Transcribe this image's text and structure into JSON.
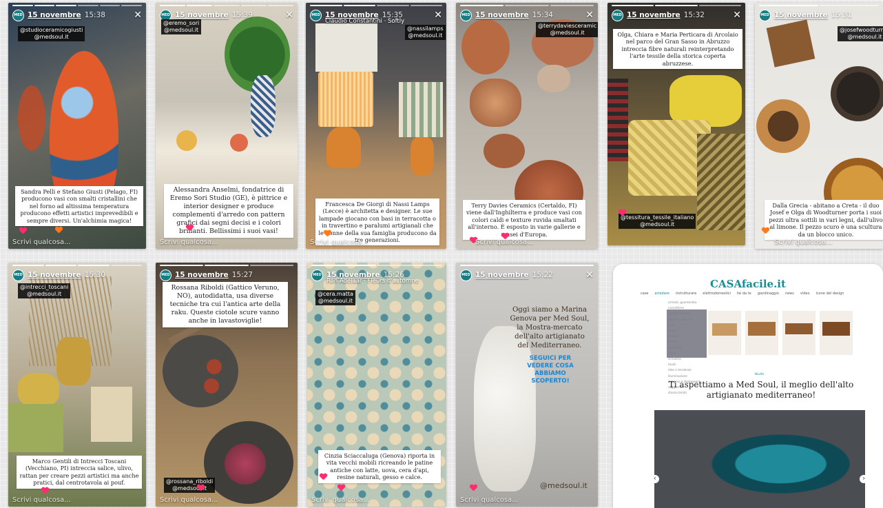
{
  "stories": [
    {
      "account": "15 novembre",
      "time": "15:38",
      "tags": [
        "@studioceramicogiusti",
        "@medsoul.it"
      ],
      "caption": "Sandra Pelli e Stefano Giusti (Pelago, FI) producono vasi con smalti cristallini che nel forno ad altissima temperatura producono effetti artistici imprevedibili e sempre diversi. Un'alchimia magica!",
      "write": "Scrivi qualcosa..."
    },
    {
      "account": "15 novembre",
      "time": "15:39",
      "tags": [
        "@eremo_sori",
        "@medsoul.it"
      ],
      "caption": "Alessandra Anselmi, fondatrice di Eremo Sori Studio (GE), è pittrice e interior designer e produce complementi d'arredo con pattern grafici dai segni decisi e i colori brillanti. Bellissimi i suoi vasi!",
      "write": "Scrivi qualcosa..."
    },
    {
      "account": "15 novembre",
      "time": "15:35",
      "sub": "Claudio Constantini · Softly",
      "tags": [
        "@nassilamps",
        "@medsoul.it"
      ],
      "caption": "Francesca De Giorgi di Nassi Lamps (Lecce) è architetta e designer. Le sue lampade giocano con basi in terracotta o in travertino e paralumi artigianali che le donne della sua famiglia producono da tre generazioni.",
      "write": "Scrivi qualcosa..."
    },
    {
      "account": "15 novembre",
      "time": "15:34",
      "tags": [
        "@terrydaviesceramic",
        "@medsoul.it"
      ],
      "caption": "Terry Davies Ceramics (Certaldo, FI) viene dall'Inghilterra e produce vasi con colori caldi e texture ruvida smaltati all'interno. È esposto in varie gallerie e musei d'Europa.",
      "write": "Scrivi qualcosa..."
    },
    {
      "account": "15 novembre",
      "time": "15:32",
      "tags": [
        "@tessitura_tessile_italiano",
        "@medsoul.it"
      ],
      "caption": "Olga, Chiara e Maria Perticara di Arcolaio nel parco del Gran Sasso in Abruzzo intreccia fibre naturali reinterpretando l'arte tessile della storica coperta abruzzese."
    },
    {
      "account": "15 novembre",
      "time": "15:31",
      "tags": [
        "@josefwoodturner",
        "@medsoul.it"
      ],
      "caption": "Dalla Grecia - abitano a Creta - il duo Josef e Olga di Woodturner porta i suoi pezzi ultra sottili in vari legni, dall'ulivo al limone. Il pezzo scuro è una scultura da un blocco unico.",
      "write": "Scrivi qualcosa..."
    },
    {
      "account": "15 novembre",
      "time": "15:30",
      "tags": [
        "@intrecci_toscani",
        "@medsoul.it"
      ],
      "caption": "Marco Gentili di Intrecci Toscani (Vecchiano, PI) intreccia salice, ulivo, rattan per creare pezzi artistici ma anche pratici, dal centrotavola ai pouf.",
      "write": "Scrivi qualcosa..."
    },
    {
      "account": "15 novembre",
      "time": "15:27",
      "tags": [
        "@rossana_riboldi",
        "@medsoul.it"
      ],
      "caption": "Rossana Riboldi (Gattico Veruno, NO), autodidatta, usa diverse tecniche tra cui l'antica arte della raku. Queste ciotole scure vanno anche in lavastoviglie!",
      "write": "Scrivi qualcosa..."
    },
    {
      "account": "15 novembre",
      "time": "15:26",
      "sub": "Ron Adelaar · Fleurs d'automne",
      "tags": [
        "@cera.matta",
        "@medsoul.it"
      ],
      "caption": "Cinzia Sciaccaluga (Genova) riporta in vita vecchi mobili ricreando le patine antiche con latte, uova, cera d'api, resine naturali, gesso e calce.",
      "write": "Scrivi qualcosa..."
    },
    {
      "account": "15 novembre",
      "time": "15:22",
      "caption": "Oggi siamo a Marina Genova per Med Soul, la Mostra-mercato dell'alto artigianato del Mediterraneo.",
      "cta": "SEGUICI PER VEDERE COSA ABBIAMO SCOPERTO!",
      "handle": "@medsoul.it",
      "write": "Scrivi qualcosa..."
    }
  ],
  "casafacile": {
    "logo": "CASAfacile.it",
    "nav": [
      "case",
      "arredare",
      "ristrutturare",
      "elettrodomestici",
      "fai da te",
      "giardinaggio",
      "news",
      "video",
      "icone del design"
    ],
    "dropdown": [
      "armadi, guardaroba",
      "cassettiere",
      "oggetti d'arredo",
      "divani e poltrone",
      "letti",
      "tappeti",
      "lampade",
      "librerie",
      "mobili TV",
      "sedie",
      "scrivanie",
      "tavoli",
      "idee e tendenze",
      "illuminazione",
      "ingresso e disimpegni",
      "soggiorno",
      "stanza bimbi"
    ],
    "promo_tag": "Novità",
    "headline": "Ti aspettiamo a Med Soul, il meglio dell'alto artigianato mediterraneo!",
    "prev": "‹",
    "next": "›"
  },
  "colors": {
    "accent": "#157d83",
    "heart": "#ff2d6f",
    "cta": "#1a86d6"
  }
}
